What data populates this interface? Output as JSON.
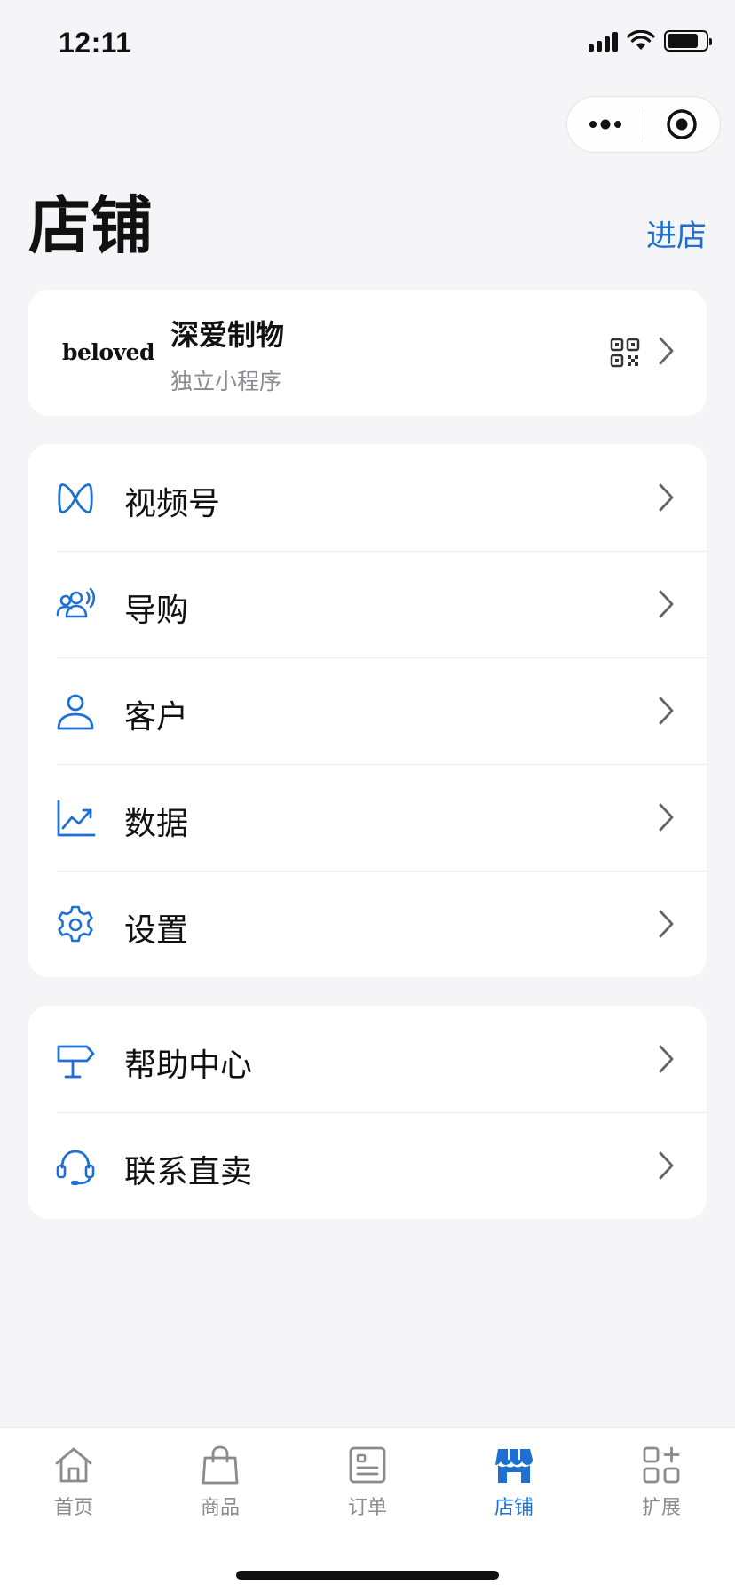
{
  "status": {
    "time": "12:11"
  },
  "header": {
    "title": "店铺",
    "enter_label": "进店"
  },
  "store": {
    "logo_text": "beloved",
    "name": "深爱制物",
    "type": "独立小程序"
  },
  "menu": [
    {
      "label": "视频号",
      "icon": "channels-icon"
    },
    {
      "label": "导购",
      "icon": "shopping-guide-icon"
    },
    {
      "label": "客户",
      "icon": "customer-icon"
    },
    {
      "label": "数据",
      "icon": "chart-icon"
    },
    {
      "label": "设置",
      "icon": "gear-icon"
    }
  ],
  "support": [
    {
      "label": "帮助中心",
      "icon": "signpost-icon"
    },
    {
      "label": "联系直卖",
      "icon": "headset-icon"
    }
  ],
  "tabs": [
    {
      "label": "首页",
      "icon": "home-icon",
      "active": false
    },
    {
      "label": "商品",
      "icon": "bag-icon",
      "active": false
    },
    {
      "label": "订单",
      "icon": "order-icon",
      "active": false
    },
    {
      "label": "店铺",
      "icon": "store-icon",
      "active": true
    },
    {
      "label": "扩展",
      "icon": "apps-plus-icon",
      "active": false
    }
  ],
  "colors": {
    "accent": "#1e6fd2",
    "background": "#f5f5f7",
    "card": "#ffffff",
    "muted": "#8a8a8f"
  }
}
